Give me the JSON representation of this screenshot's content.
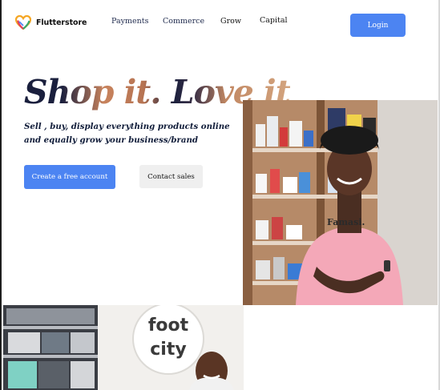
{
  "brand": {
    "name": "Flutterstore",
    "logo_icon": "heart-logo-icon",
    "accent": "#4c84f2"
  },
  "nav": {
    "links": [
      "Payments",
      "Commerce",
      "Grow",
      "Capital"
    ],
    "login_label": "Login"
  },
  "hero": {
    "title": "Shop it. Love it",
    "subtitle": "Sell , buy, display everything products online and equally grow your business/brand",
    "primary_cta": "Create a free account",
    "secondary_cta": "Contact sales"
  },
  "photos": {
    "shirt_text": "Famasi.",
    "store_sign_line1": "foot",
    "store_sign_line2": "city"
  }
}
